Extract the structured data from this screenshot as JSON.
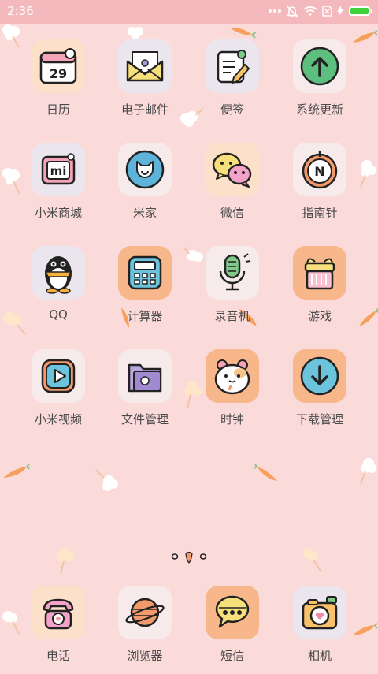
{
  "status": {
    "time": "2:36"
  },
  "apps": [
    {
      "label": "日历",
      "icon": "calendar-icon",
      "day": "29"
    },
    {
      "label": "电子邮件",
      "icon": "email-icon"
    },
    {
      "label": "便签",
      "icon": "notes-icon"
    },
    {
      "label": "系统更新",
      "icon": "system-update-icon"
    },
    {
      "label": "小米商城",
      "icon": "mi-store-icon",
      "mark": "mi"
    },
    {
      "label": "米家",
      "icon": "mijia-icon"
    },
    {
      "label": "微信",
      "icon": "wechat-icon"
    },
    {
      "label": "指南针",
      "icon": "compass-icon",
      "mark": "N"
    },
    {
      "label": "QQ",
      "icon": "qq-penguin-icon"
    },
    {
      "label": "计算器",
      "icon": "calculator-icon"
    },
    {
      "label": "录音机",
      "icon": "recorder-icon"
    },
    {
      "label": "游戏",
      "icon": "game-gift-icon"
    },
    {
      "label": "小米视频",
      "icon": "video-play-icon"
    },
    {
      "label": "文件管理",
      "icon": "file-manager-icon"
    },
    {
      "label": "时钟",
      "icon": "clock-hamster-icon"
    },
    {
      "label": "下载管理",
      "icon": "download-icon"
    }
  ],
  "dock": [
    {
      "label": "电话",
      "icon": "phone-icon"
    },
    {
      "label": "浏览器",
      "icon": "browser-planet-icon"
    },
    {
      "label": "短信",
      "icon": "message-icon"
    },
    {
      "label": "相机",
      "icon": "camera-icon"
    }
  ],
  "colors": {
    "background": "#fbdada",
    "statusbar": "#f4b9bd",
    "battery": "#3ed13a"
  }
}
